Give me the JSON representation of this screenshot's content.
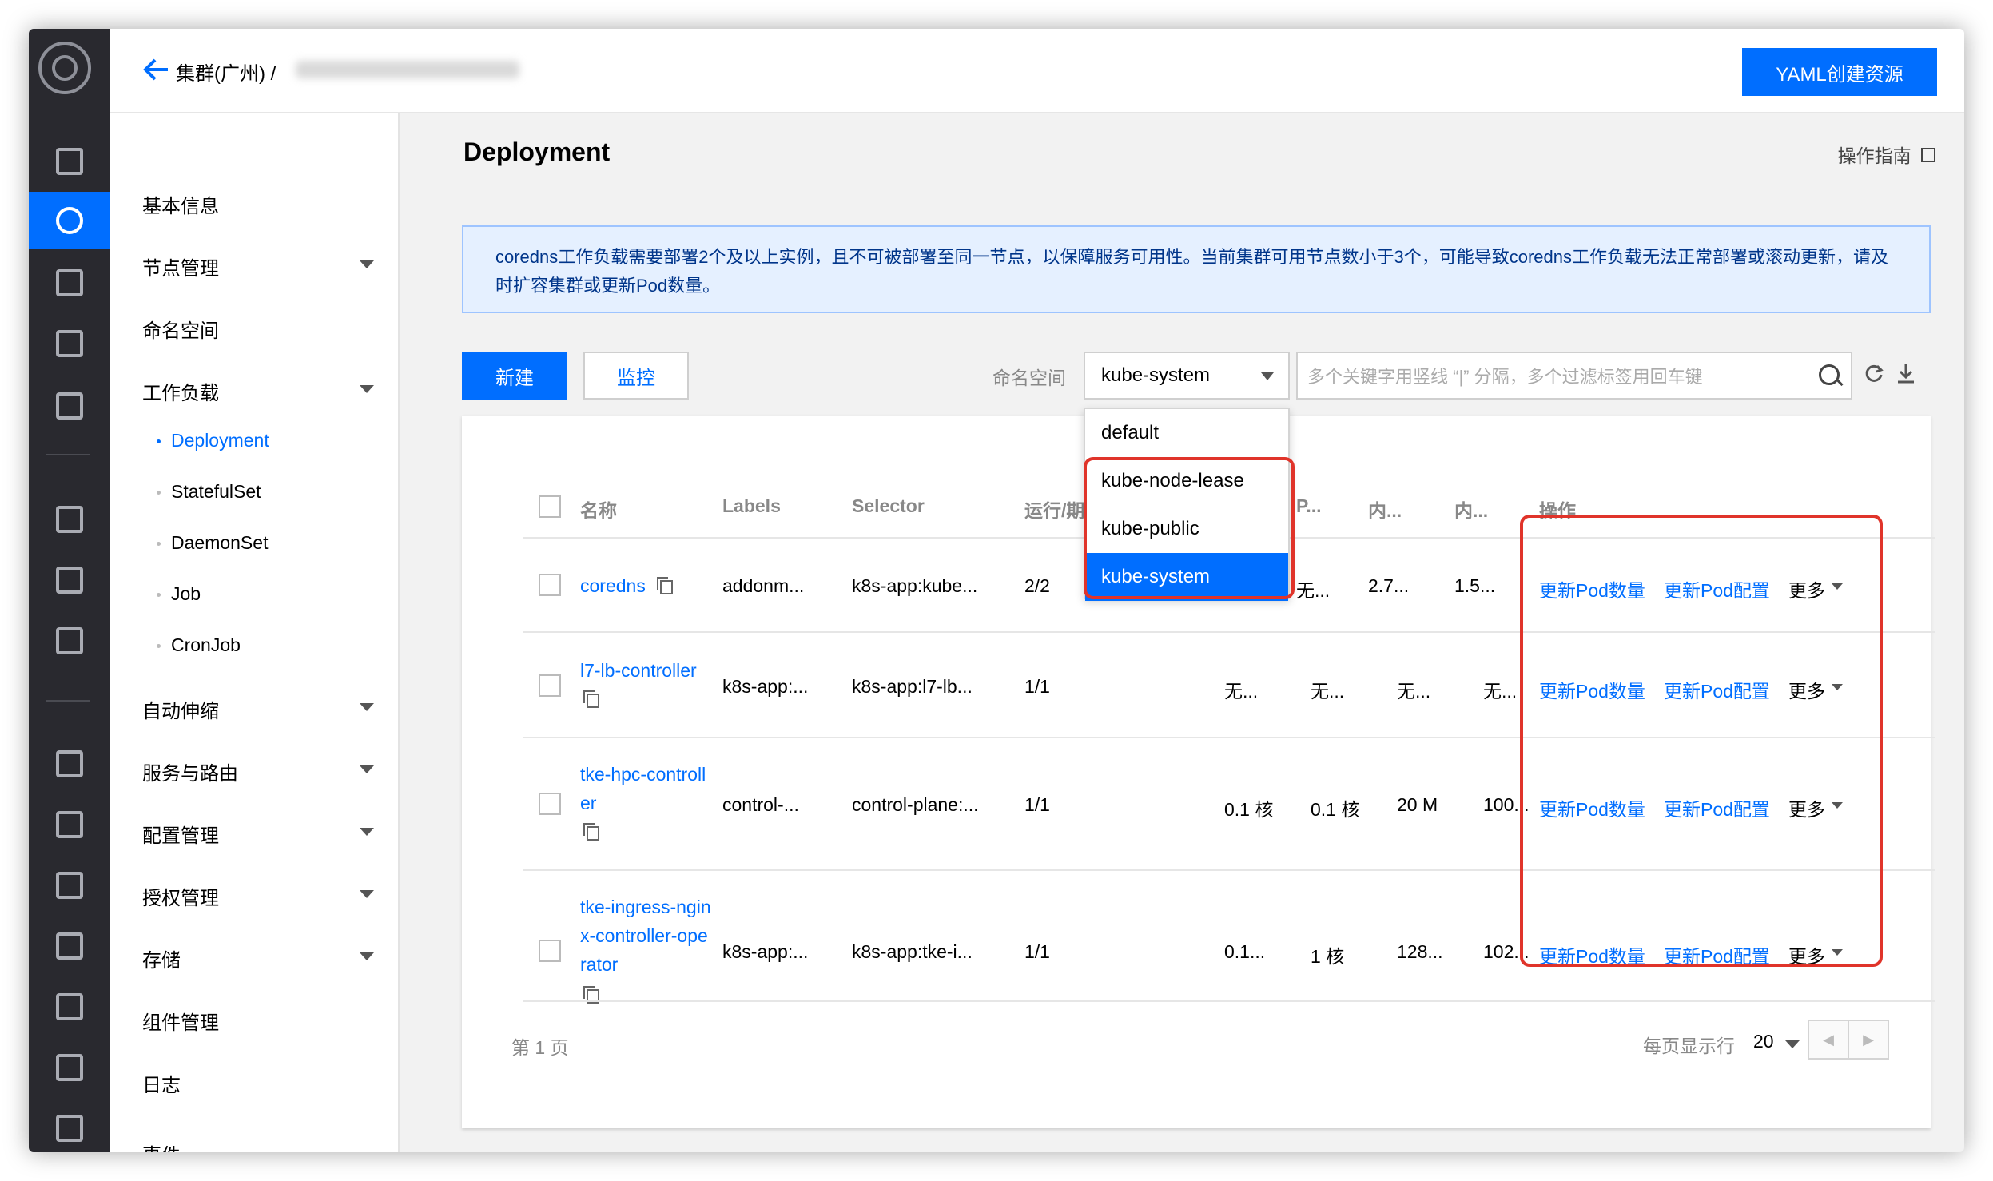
{
  "header": {
    "breadcrumb": "集群(广州) /",
    "yaml_button": "YAML创建资源"
  },
  "sidenav": {
    "items": [
      "基本信息",
      "节点管理",
      "命名空间",
      "工作负载",
      "自动伸缩",
      "服务与路由",
      "配置管理",
      "授权管理",
      "存储",
      "组件管理",
      "日志",
      "事件"
    ],
    "workload_sub": [
      "Deployment",
      "StatefulSet",
      "DaemonSet",
      "Job",
      "CronJob"
    ]
  },
  "main": {
    "title": "Deployment",
    "guide": "操作指南",
    "alert": "coredns工作负载需要部署2个及以上实例，且不可被部署至同一节点，以保障服务可用性。当前集群可用节点数小于3个，可能导致coredns工作负载无法正常部署或滚动更新，请及时扩容集群或更新Pod数量。",
    "btn_new": "新建",
    "btn_monitor": "监控",
    "ns_label": "命名空间",
    "ns_selected": "kube-system",
    "search_placeholder": "多个关键字用竖线 “|” 分隔，多个过滤标签用回车键",
    "namespace_options": [
      "default",
      "kube-node-lease",
      "kube-public",
      "kube-system"
    ]
  },
  "table": {
    "headers": {
      "name": "名称",
      "labels": "Labels",
      "selector": "Selector",
      "running": "运行/期",
      "p": "P...",
      "mem1": "内...",
      "mem2": "内...",
      "ops": "操作"
    },
    "rows": [
      {
        "name": "coredns",
        "labels": "addonm...",
        "selector": "k8s-app:kube...",
        "running": "2/2",
        "c1": "无...",
        "c2": "",
        "c3": "2.7...",
        "c4": "1.5..."
      },
      {
        "name": "l7-lb-controller",
        "labels": "k8s-app:...",
        "selector": "k8s-app:l7-lb...",
        "running": "1/1",
        "c1": "无...",
        "c2": "无...",
        "c3": "无...",
        "c4": "无..."
      },
      {
        "name1": "tke-hpc-controll",
        "name2": "er",
        "labels": "control-...",
        "selector": "control-plane:...",
        "running": "1/1",
        "c1": "0.1 核",
        "c2": "0.1 核",
        "c3": "20 M",
        "c4": "100..."
      },
      {
        "name1": "tke-ingress-ngin",
        "name2": "x-controller-ope",
        "name3": "rator",
        "labels": "k8s-app:...",
        "selector": "k8s-app:tke-i...",
        "running": "1/1",
        "c1": "0.1...",
        "c2": "1 核",
        "c3": "128...",
        "c4": "102..."
      }
    ],
    "op_update_count": "更新Pod数量",
    "op_update_config": "更新Pod配置",
    "op_more": "更多"
  },
  "pager": {
    "page": "第 1 页",
    "per_page_label": "每页显示行",
    "per_page": "20"
  }
}
